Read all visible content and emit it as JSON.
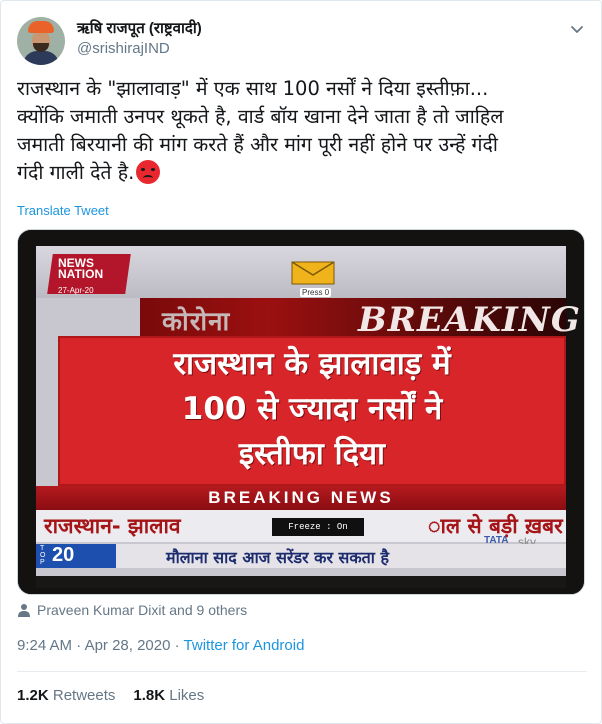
{
  "user": {
    "display_name": "ऋषि राजपूत (राष्ट्रवादी)",
    "handle": "@srishirajIND"
  },
  "tweet": {
    "text": "राजस्थान के \"झालावाड़\" में एक साथ 100 नर्सों ने दिया इस्तीफ़ा...\nक्योंकि जमाती उनपर थूकते है, वार्ड बॉय खाना देने जाता है तो जाहिल\nजमाती बिरयानी की मांग करते हैं और मांग पूरी नहीं होने पर उन्हें गंदी\nगंदी गाली देते है.",
    "emoji": "angry-face",
    "translate_label": "Translate Tweet"
  },
  "media": {
    "channel_logo": "NEWS\nNATION",
    "channel_date": "27-Apr-20",
    "press_logo": "Press 0",
    "corona_label": "कोरोना",
    "breaking_label": "BREAKING",
    "headline": "राजस्थान के झालावाड़ में\n100 से ज्यादा नर्सों ने\nइस्तीफा दिया",
    "breaking_news_label": "BREAKING NEWS",
    "ticker_left": "राजस्थान- झालाव",
    "ticker_right": "ाल से बड़ी ख़बर",
    "freeze_label": "Freeze : On",
    "provider_tata": "TATA",
    "provider_sky": "sky",
    "top_letters": "T\nO\nP",
    "top_number": "20",
    "ticker_bottom": "मौलाना साद आज सरेंडर कर सकता है"
  },
  "tagged": {
    "text": "Praveen Kumar Dixit and 9 others",
    "icon": "person-icon"
  },
  "meta": {
    "time": "9:24 AM",
    "separator": " · ",
    "date": "Apr 28, 2020",
    "source": "Twitter for Android"
  },
  "stats": {
    "retweets_count": "1.2K",
    "retweets_label": "Retweets",
    "likes_count": "1.8K",
    "likes_label": "Likes"
  },
  "colors": {
    "link": "#1b95e0",
    "secondary_text": "#657786",
    "breaking_red": "#d8252a"
  }
}
